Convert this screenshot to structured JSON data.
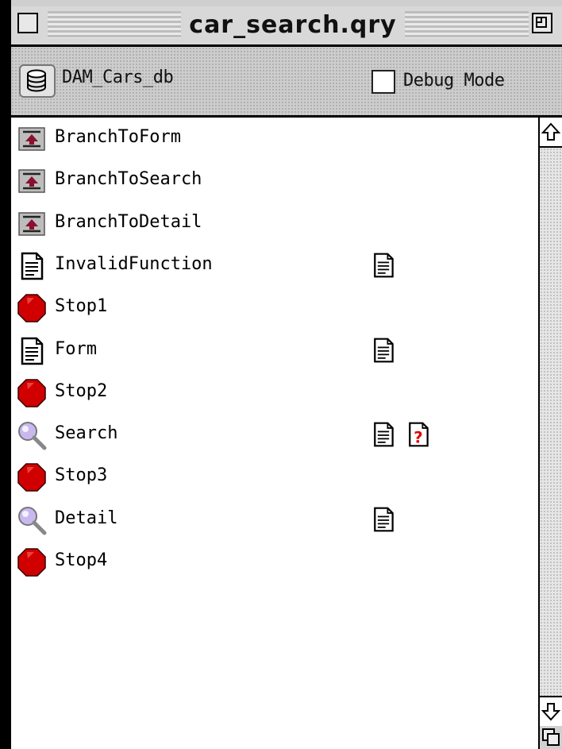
{
  "window": {
    "title": "car_search.qry"
  },
  "toolbar": {
    "database_name": "DAM_Cars_db",
    "debug_label": "Debug Mode",
    "debug_checked": false
  },
  "items": [
    {
      "label": "BranchToForm",
      "icon": "branch-icon",
      "attachments": []
    },
    {
      "label": "BranchToSearch",
      "icon": "branch-icon",
      "attachments": []
    },
    {
      "label": "BranchToDetail",
      "icon": "branch-icon",
      "attachments": []
    },
    {
      "label": "InvalidFunction",
      "icon": "document-icon",
      "attachments": [
        "document-icon"
      ]
    },
    {
      "label": "Stop1",
      "icon": "stop-icon",
      "attachments": []
    },
    {
      "label": "Form",
      "icon": "document-icon",
      "attachments": [
        "document-icon"
      ]
    },
    {
      "label": "Stop2",
      "icon": "stop-icon",
      "attachments": []
    },
    {
      "label": "Search",
      "icon": "magnifier-icon",
      "attachments": [
        "document-icon",
        "help-document-icon"
      ]
    },
    {
      "label": "Stop3",
      "icon": "stop-icon",
      "attachments": []
    },
    {
      "label": "Detail",
      "icon": "magnifier-icon",
      "attachments": [
        "document-icon"
      ]
    },
    {
      "label": "Stop4",
      "icon": "stop-icon",
      "attachments": []
    }
  ],
  "colors": {
    "stop": "#d10000",
    "branch_arrow": "#8a1030",
    "help_mark": "#e00000",
    "magnifier_lens": "#c9b8f0"
  }
}
